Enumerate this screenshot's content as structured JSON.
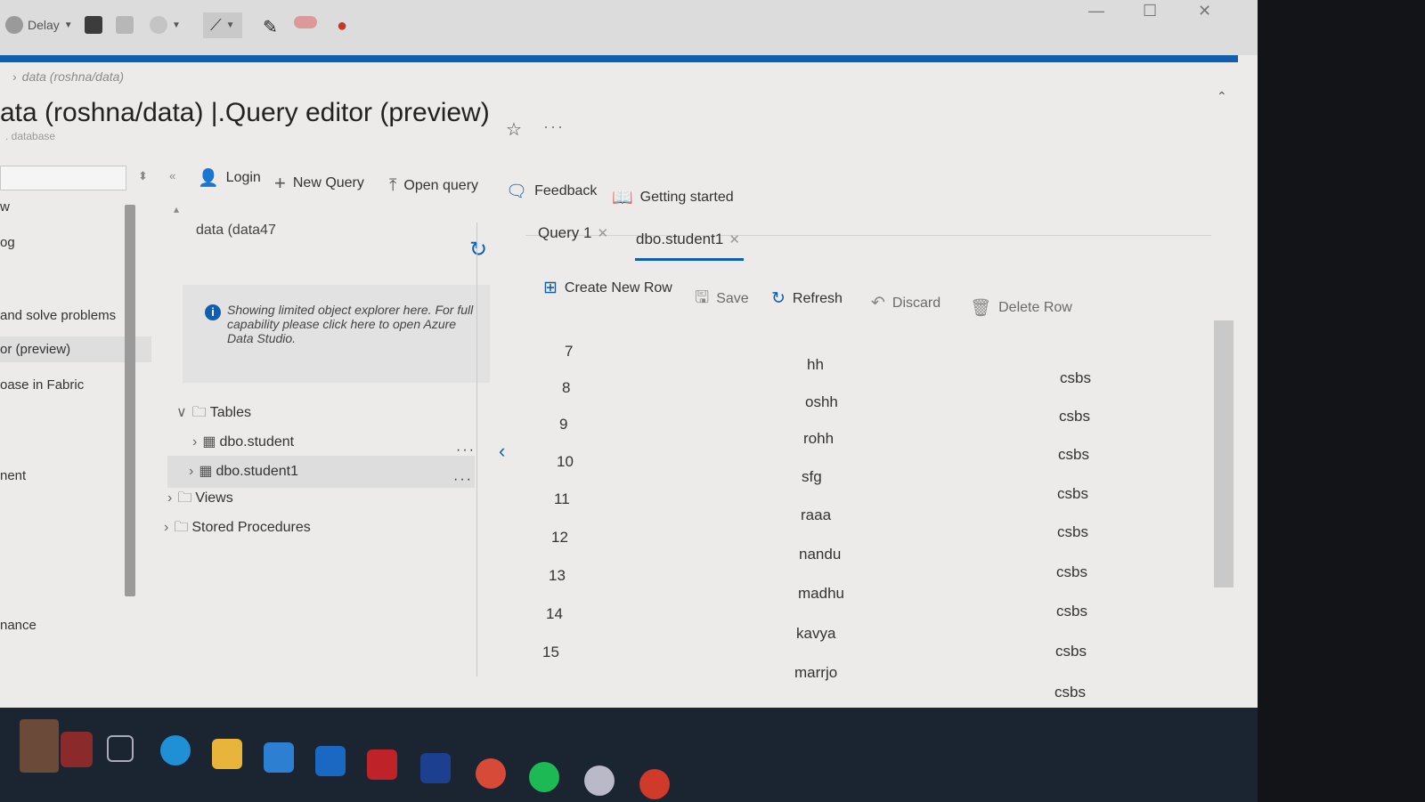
{
  "snipbar": {
    "delay_label": "Delay",
    "icons": [
      "delay-icon",
      "save-icon",
      "copy-icon",
      "share-icon",
      "pen-icon",
      "highlighter-icon",
      "eraser-icon",
      "touch-icon"
    ]
  },
  "window_controls": {
    "minimize": "—",
    "maximize": "☐",
    "close": "✕"
  },
  "breadcrumb": "data (roshna/data)",
  "page": {
    "title": "ata (roshna/data) |.Query editor (preview)",
    "subtitle": ". database",
    "more": "···"
  },
  "leftnav": {
    "items": [
      "w",
      "og",
      "and solve problems",
      "or (preview)",
      "oase in Fabric",
      "nent",
      "nance"
    ],
    "active_item": "or (preview)"
  },
  "toolbar": {
    "login": "Login",
    "new_query": "New Query",
    "open_query": "Open query",
    "feedback": "Feedback",
    "getting_started": "Getting started"
  },
  "explorer": {
    "title": "data (data47",
    "info": "Showing limited object explorer here. For full capability please click here to open Azure Data Studio.",
    "tree": {
      "tables": "Tables",
      "table_items": [
        "dbo.student",
        "dbo.student1"
      ],
      "views": "Views",
      "stored_procedures": "Stored Procedures"
    },
    "row_more": "···"
  },
  "tabs": [
    {
      "label": "Query 1",
      "active": false
    },
    {
      "label": "dbo.student1",
      "active": true
    }
  ],
  "grid_toolbar": {
    "create_new_row": "Create New Row",
    "save": "Save",
    "refresh": "Refresh",
    "discard": "Discard",
    "delete_row": "Delete Row"
  },
  "grid": {
    "rows": [
      {
        "id": "7",
        "name": "hh",
        "dept": "csbs"
      },
      {
        "id": "8",
        "name": "oshh",
        "dept": "csbs"
      },
      {
        "id": "9",
        "name": "rohh",
        "dept": "csbs"
      },
      {
        "id": "10",
        "name": "sfg",
        "dept": "csbs"
      },
      {
        "id": "11",
        "name": "raaa",
        "dept": "csbs"
      },
      {
        "id": "12",
        "name": "nandu",
        "dept": "csbs"
      },
      {
        "id": "13",
        "name": "madhu",
        "dept": "csbs"
      },
      {
        "id": "14",
        "name": "kavya",
        "dept": "csbs"
      },
      {
        "id": "15",
        "name": "marrjo",
        "dept": "csbs"
      }
    ]
  },
  "taskbar": {
    "icons": [
      "user-photo-icon",
      "task-view-icon",
      "edge-icon",
      "file-explorer-icon",
      "mail-icon",
      "outlook-icon",
      "mcafee-icon",
      "l-app-icon",
      "chrome-icon",
      "spotify-icon",
      "app-icon",
      "app-icon-2"
    ]
  },
  "colors": {
    "accent": "#0f5fae",
    "taskbar": "#1b2431",
    "background": "#ecebea"
  }
}
